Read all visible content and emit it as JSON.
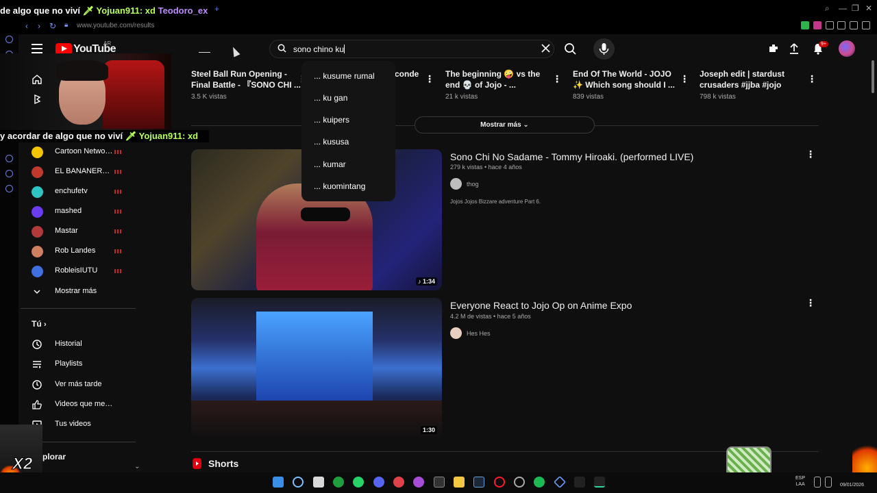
{
  "browser": {
    "tab_ticker": [
      {
        "text": "de algo que no viví ",
        "style": "t1"
      },
      {
        "text": "🗡 Yojuan911: xd ",
        "style": "t2"
      },
      {
        "text": "Teodoro_ex",
        "style": "t4"
      }
    ],
    "new_tab_label": "+",
    "url": "www.youtube.com/results"
  },
  "header": {
    "logo_text": "YouTube",
    "country_code": "AR",
    "search": {
      "value": "sono chino ku"
    },
    "notification_badge": "9+"
  },
  "webcam_chat": [
    {
      "text": "y acordar de algo que no viví ",
      "style": "t1"
    },
    {
      "text": "🗡 Yojuan911: xd",
      "style": "t2"
    }
  ],
  "sidebar": {
    "subscriptions": [
      {
        "label": "Cartoon Network...",
        "color": "#f5c400",
        "live": true
      },
      {
        "label": "EL BANANERO O...",
        "color": "#c0392b",
        "live": true
      },
      {
        "label": "enchufetv",
        "color": "#2ec4c4",
        "live": true
      },
      {
        "label": "mashed",
        "color": "#6a3df0",
        "live": true
      },
      {
        "label": "Mastar",
        "color": "#b23a3a",
        "live": true
      },
      {
        "label": "Rob Landes",
        "color": "#d08060",
        "live": true
      },
      {
        "label": "RobleisIUTU",
        "color": "#3f6fe0",
        "live": true
      }
    ],
    "show_more": "Mostrar más",
    "you_section": "Tú",
    "you_items": [
      {
        "label": "Historial",
        "icon": "history-icon"
      },
      {
        "label": "Playlists",
        "icon": "playlists-icon"
      },
      {
        "label": "Ver más tarde",
        "icon": "watch-later-icon"
      },
      {
        "label": "Videos que me gus...",
        "icon": "like-icon"
      },
      {
        "label": "Tus videos",
        "icon": "your-videos-icon"
      }
    ],
    "explore_tail": "plorar",
    "x2_label": "X2"
  },
  "search_suggestions": [
    "... kusume rumal",
    "... ku gan",
    "... kuipers",
    "... kususa",
    "... kumar",
    "... kuomintang"
  ],
  "top_row": [
    {
      "title": "Steel Ball Run Opening - Final Battle - 『SONO CHI ...",
      "views": "3.5 K vistas"
    },
    {
      "title": "conde",
      "views": ""
    },
    {
      "title": "The beginning 🤪 vs the end 💀 of Jojo - ...",
      "views": "21 k vistas"
    },
    {
      "title": "End Of The World - JOJO ✨ Which song should I ...",
      "views": "839 vistas"
    },
    {
      "title": "Joseph edit | stardust crusaders #jjba #jojo #edi...",
      "views": "798 k vistas"
    }
  ],
  "show_more_button": "Mostrar más",
  "results": [
    {
      "title": "Sono Chi No Sadame - Tommy Hiroaki. (performed LIVE)",
      "meta": "279 k vistas • hace 4 años",
      "channel": "thog",
      "description": "Jojos Jojos Bizzare adventure Part 6.",
      "duration": "1:34"
    },
    {
      "title": "Everyone React to Jojo Op on Anime Expo",
      "meta": "4.2 M de vistas • hace 5 años",
      "channel": "Hes Hes",
      "description": "",
      "duration": "1:30"
    }
  ],
  "shorts_title": "Shorts",
  "taskbar": {
    "language": "ESP\nLAA",
    "date": "09/01/2026"
  },
  "colors": {
    "background": "#0f0f0f",
    "yt_red": "#ff0000",
    "accent_browser": "#7c8ef0"
  }
}
